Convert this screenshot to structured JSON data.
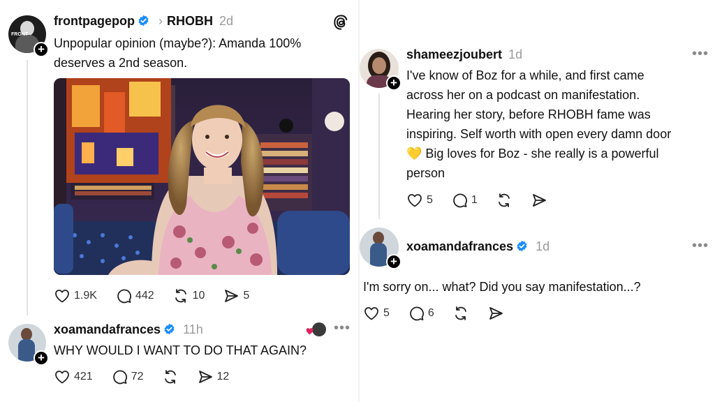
{
  "left": {
    "main_post": {
      "username": "frontpagepop",
      "breadcrumb_sep": "›",
      "community": "RHOBH",
      "time": "2d",
      "avatar_text": "FRONT",
      "text": "Unpopular opinion (maybe?): Amanda 100% deserves a 2nd season.",
      "likes": "1.9K",
      "comments": "442",
      "reposts": "10",
      "shares": "5"
    },
    "reply": {
      "username": "xoamandafrances",
      "time": "11h",
      "text": "WHY WOULD I WANT TO DO THAT AGAIN?",
      "likes": "421",
      "comments": "72",
      "shares": "12"
    }
  },
  "right": {
    "comment": {
      "username": "shameezjoubert",
      "time": "1d",
      "text_lines": [
        "I've know of Boz for a while, and first came",
        "across her on a podcast on manifestation.",
        "Hearing her story, before RHOBH fame was",
        "inspiring. Self worth with open every damn door",
        "💛 Big loves for Boz - she really is a powerful",
        "person"
      ],
      "likes": "5",
      "comments": "1"
    },
    "reply": {
      "username": "xoamandafrances",
      "time": "1d",
      "text": "I'm sorry on... what? Did you say manifestation...?",
      "likes": "5",
      "comments": "6"
    }
  },
  "icons": {
    "app": "threads-icon",
    "verified": "verified-badge-icon",
    "like": "heart-icon",
    "comment": "comment-icon",
    "repost": "repost-icon",
    "share": "share-icon",
    "more": "more-options-icon"
  },
  "colors": {
    "verified": "#1a8cff",
    "muted": "#9a9a9a",
    "like_heart": "#e0245e"
  }
}
